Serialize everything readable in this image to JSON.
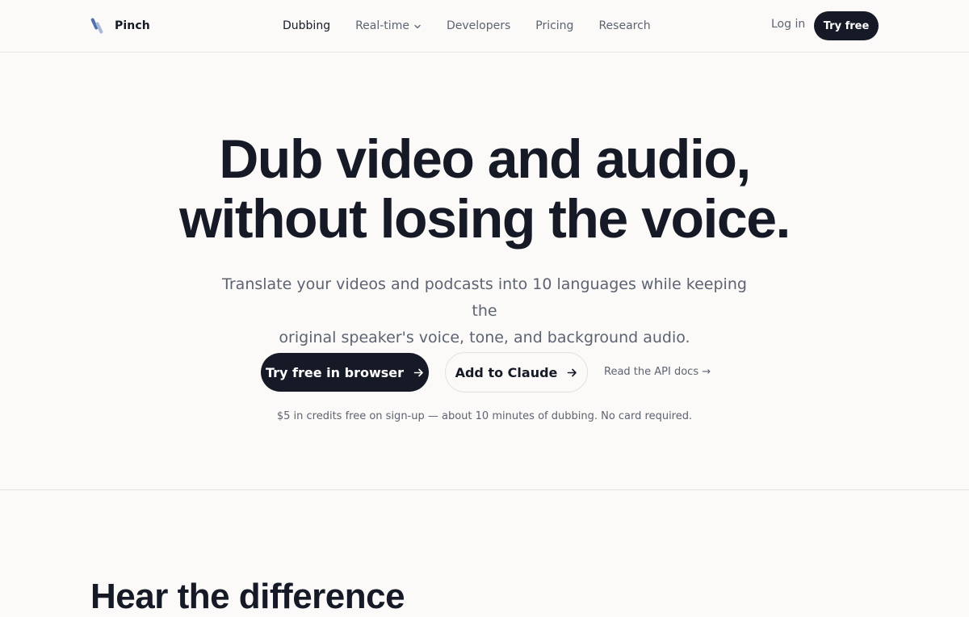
{
  "brand": {
    "name": "Pinch",
    "logo_icon": "pinch-logo-icon"
  },
  "nav": {
    "links": [
      {
        "label": "Dubbing",
        "active": true
      },
      {
        "label": "Real-time",
        "has_dropdown": true
      },
      {
        "label": "Developers"
      },
      {
        "label": "Pricing"
      },
      {
        "label": "Research"
      }
    ],
    "login": "Log in",
    "try_free": "Try free"
  },
  "hero": {
    "title_line1": "Dub video and audio,",
    "title_line2": "without losing the voice.",
    "subtitle_line1": "Translate your videos and podcasts into 10 languages while keeping the",
    "subtitle_line2": "original speaker's voice, tone, and background audio.",
    "cta_primary": "Try free in browser",
    "cta_secondary": "Add to Claude",
    "api_link": "Read the API docs →",
    "fine_print": "$5 in credits free on sign-up — about 10 minutes of dubbing. No card required."
  },
  "section": {
    "title": "Hear the difference"
  },
  "colors": {
    "background": "#fbfaf8",
    "primary": "#151a26",
    "muted_text": "#5d6371",
    "logo_accent": "#7a8fb8"
  }
}
